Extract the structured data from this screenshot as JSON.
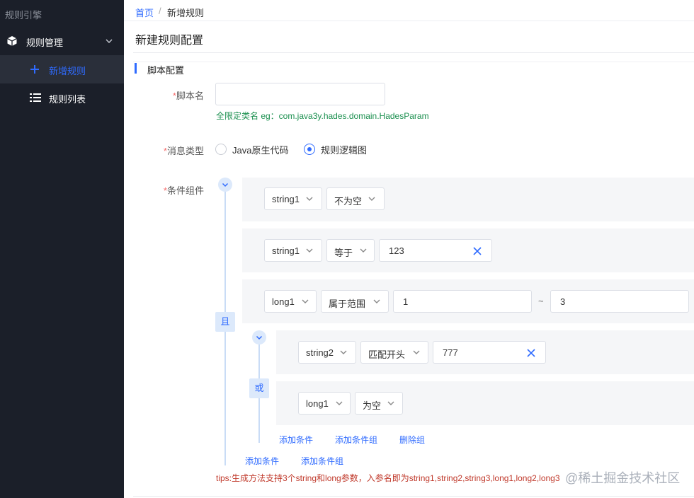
{
  "sidebar": {
    "logo": "规则引擎",
    "menu": {
      "label": "规则管理",
      "icon": "cube-icon"
    },
    "items": [
      {
        "label": "新增规则",
        "icon": "plus-icon",
        "active": true
      },
      {
        "label": "规则列表",
        "icon": "list-icon",
        "active": false
      }
    ]
  },
  "breadcrumb": {
    "home": "首页",
    "separator": "/",
    "current": "新增规则"
  },
  "page": {
    "title": "新建规则配置"
  },
  "section": {
    "title": "脚本配置"
  },
  "form": {
    "script_name": {
      "required": "*",
      "label": "脚本名",
      "value": "",
      "hint": "全限定类名 eg：com.java3y.hades.domain.HadesParam"
    },
    "message_type": {
      "required": "*",
      "label": "消息类型",
      "options": [
        {
          "label": "Java原生代码",
          "selected": false
        },
        {
          "label": "规则逻辑图",
          "selected": true
        }
      ]
    },
    "conditions": {
      "required": "*",
      "label": "条件组件",
      "outer_op": "且",
      "rows": [
        {
          "field": "string1",
          "op": "不为空"
        },
        {
          "field": "string1",
          "op": "等于",
          "value": "123"
        },
        {
          "field": "long1",
          "op": "属于范围",
          "min": "1",
          "tilde": "~",
          "max": "3"
        }
      ],
      "inner_group": {
        "op": "或",
        "rows": [
          {
            "field": "string2",
            "op": "匹配开头",
            "value": "777"
          },
          {
            "field": "long1",
            "op": "为空"
          }
        ],
        "actions": {
          "add_condition": "添加条件",
          "add_group": "添加条件组",
          "delete_group": "删除组"
        }
      },
      "actions": {
        "add_condition": "添加条件",
        "add_group": "添加条件组"
      }
    },
    "tips": "tips:生成方法支持3个string和long参数，入参名即为string1,string2,string3,long1,long2,long3"
  },
  "watermark": "@稀土掘金技术社区",
  "colors": {
    "sidebar_bg": "#1b1f29",
    "accent": "#2f6bff",
    "hint_green": "#1a8f4e",
    "tips_red": "#c0392b"
  }
}
